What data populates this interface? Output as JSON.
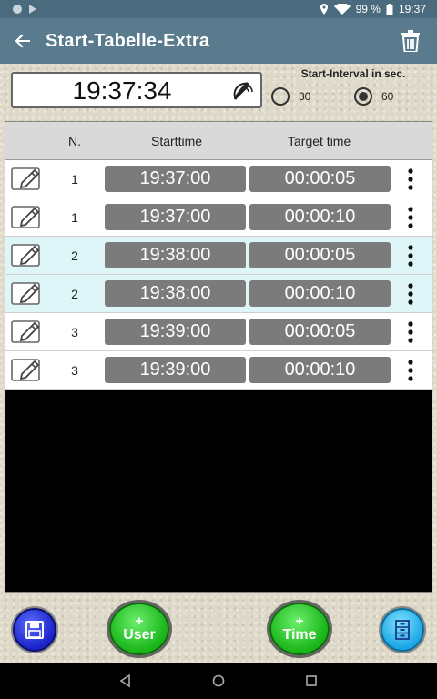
{
  "status_bar": {
    "battery": "99 %",
    "time": "19:37"
  },
  "app_bar": {
    "title": "Start-Tabelle-Extra"
  },
  "clock": {
    "time": "19:37:34"
  },
  "interval": {
    "title": "Start-Interval in sec.",
    "options": [
      {
        "label": "30",
        "checked": false
      },
      {
        "label": "60",
        "checked": true
      }
    ]
  },
  "table": {
    "headers": {
      "n": "N.",
      "start": "Starttime",
      "target": "Target time"
    },
    "rows": [
      {
        "n": "1",
        "start": "19:37:00",
        "target": "00:00:05",
        "highlight": false
      },
      {
        "n": "1",
        "start": "19:37:00",
        "target": "00:00:10",
        "highlight": false
      },
      {
        "n": "2",
        "start": "19:38:00",
        "target": "00:00:05",
        "highlight": true
      },
      {
        "n": "2",
        "start": "19:38:00",
        "target": "00:00:10",
        "highlight": true
      },
      {
        "n": "3",
        "start": "19:39:00",
        "target": "00:00:05",
        "highlight": false
      },
      {
        "n": "3",
        "start": "19:39:00",
        "target": "00:00:10",
        "highlight": false
      }
    ]
  },
  "buttons": {
    "add_user": {
      "plus": "+",
      "label": "User"
    },
    "add_time": {
      "plus": "+",
      "label": "Time"
    }
  },
  "colors": {
    "app_bar": "#5a7a8e",
    "status_bar": "#4a6a7d",
    "time_cell": "#7b7b7b",
    "highlight_row": "#dff6f8",
    "save_button": "#1a22c8",
    "green_button": "#18b418",
    "file_button": "#1ba6e6"
  },
  "icons": {
    "back": "arrow-left-icon",
    "delete": "trash-icon",
    "clock": "satellite-dish-icon",
    "edit": "pencil-edit-icon",
    "more": "more-vertical-icon",
    "save": "floppy-disk-icon",
    "file": "file-cabinet-icon"
  }
}
